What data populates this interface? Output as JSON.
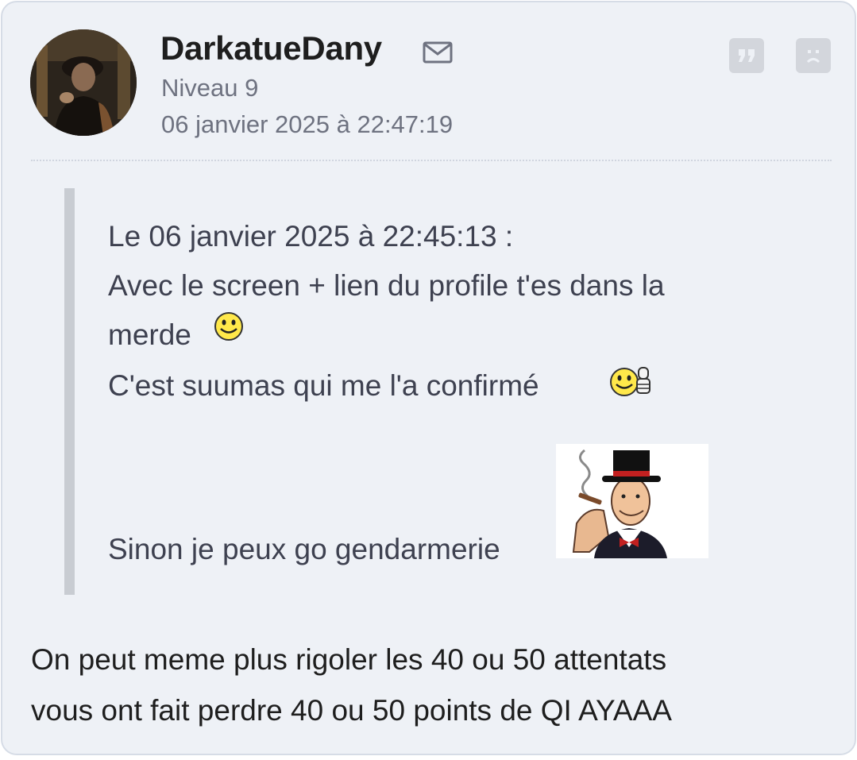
{
  "author": {
    "username": "DarkatueDany",
    "level": "Niveau 9",
    "post_date": "06 janvier 2025 à 22:47:19"
  },
  "icons": {
    "mail": "mail-icon",
    "quote": "quote-icon",
    "report": "report-icon",
    "smiley": "smiley-icon",
    "smiley_wink": "smiley-thumbs-icon",
    "sticker": "gentleman-cigar-sticker"
  },
  "quote": {
    "header": "Le 06 janvier 2025 à 22:45:13 :",
    "line1": "Avec le screen + lien du profile t'es dans la",
    "line2": "merde",
    "line3": "C'est suumas qui me l'a confirmé",
    "line4": "Sinon je peux go gendarmerie"
  },
  "message": {
    "line1": "On peut meme plus rigoler les 40 ou 50 attentats",
    "line2": "vous ont fait perdre 40 ou 50 points de QI AYAAA"
  },
  "colors": {
    "card_bg": "#eef1f6",
    "quote_bar": "#c8ccd2",
    "meta_text": "#6e7280",
    "button_bg": "#d3d6dc"
  }
}
